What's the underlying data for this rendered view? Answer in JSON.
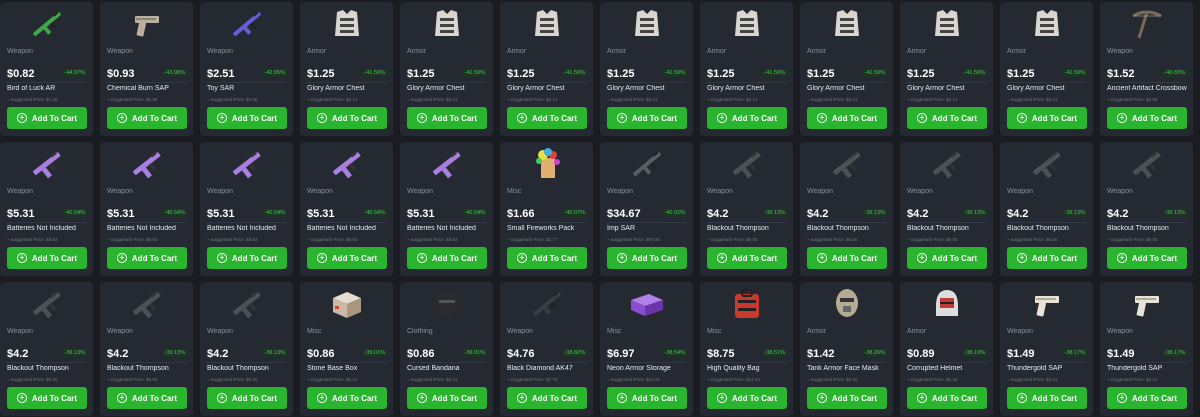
{
  "cart_label": "Add To Cart",
  "suggested_prefix": "Suggested Price:",
  "items": [
    {
      "category": "Weapon",
      "price": "$0.82",
      "discount": "-44.97%",
      "name": "Bird of Luck AR",
      "suggested": "$1.49",
      "icon": "rifle-icon",
      "color": "#3ea84a"
    },
    {
      "category": "Weapon",
      "price": "$0.93",
      "discount": "-43.98%",
      "name": "Chemical Burn SAP",
      "suggested": "$1.66",
      "icon": "pistol-icon",
      "color": "#b9b0a0"
    },
    {
      "category": "Weapon",
      "price": "$2.51",
      "discount": "-42.95%",
      "name": "Toy SAR",
      "suggested": "$4.40",
      "icon": "rifle-icon",
      "color": "#6c5bd8"
    },
    {
      "category": "Armor",
      "price": "$1.25",
      "discount": "-41.59%",
      "name": "Glory Armor Chest",
      "suggested": "$2.14",
      "icon": "armor-chest-icon",
      "color": "#d9d6cf"
    },
    {
      "category": "Armor",
      "price": "$1.25",
      "discount": "-41.59%",
      "name": "Glory Armor Chest",
      "suggested": "$2.14",
      "icon": "armor-chest-icon",
      "color": "#d9d6cf"
    },
    {
      "category": "Armor",
      "price": "$1.25",
      "discount": "-41.59%",
      "name": "Glory Armor Chest",
      "suggested": "$2.14",
      "icon": "armor-chest-icon",
      "color": "#d9d6cf"
    },
    {
      "category": "Armor",
      "price": "$1.25",
      "discount": "-41.59%",
      "name": "Glory Armor Chest",
      "suggested": "$2.14",
      "icon": "armor-chest-icon",
      "color": "#d9d6cf"
    },
    {
      "category": "Armor",
      "price": "$1.25",
      "discount": "-41.59%",
      "name": "Glory Armor Chest",
      "suggested": "$2.14",
      "icon": "armor-chest-icon",
      "color": "#d9d6cf"
    },
    {
      "category": "Armor",
      "price": "$1.25",
      "discount": "-41.59%",
      "name": "Glory Armor Chest",
      "suggested": "$2.14",
      "icon": "armor-chest-icon",
      "color": "#d9d6cf"
    },
    {
      "category": "Armor",
      "price": "$1.25",
      "discount": "-41.59%",
      "name": "Glory Armor Chest",
      "suggested": "$2.14",
      "icon": "armor-chest-icon",
      "color": "#d9d6cf"
    },
    {
      "category": "Armor",
      "price": "$1.25",
      "discount": "-41.59%",
      "name": "Glory Armor Chest",
      "suggested": "$2.14",
      "icon": "armor-chest-icon",
      "color": "#d9d6cf"
    },
    {
      "category": "Weapon",
      "price": "$1.52",
      "discount": "-40.83%",
      "name": "Ancient Artifact Crossbow",
      "suggested": "$2.56",
      "icon": "crossbow-icon",
      "color": "#7a6a55"
    },
    {
      "category": "Weapon",
      "price": "$5.31",
      "discount": "-40.54%",
      "name": "Batteries Not Included",
      "suggested": "$8.93",
      "icon": "smg-icon",
      "color": "#a87ee0"
    },
    {
      "category": "Weapon",
      "price": "$5.31",
      "discount": "-40.54%",
      "name": "Batteries Not Included",
      "suggested": "$8.93",
      "icon": "smg-icon",
      "color": "#a87ee0"
    },
    {
      "category": "Weapon",
      "price": "$5.31",
      "discount": "-40.54%",
      "name": "Batteries Not Included",
      "suggested": "$8.93",
      "icon": "smg-icon",
      "color": "#a87ee0"
    },
    {
      "category": "Weapon",
      "price": "$5.31",
      "discount": "-40.54%",
      "name": "Batteries Not Included",
      "suggested": "$8.93",
      "icon": "smg-icon",
      "color": "#a87ee0"
    },
    {
      "category": "Weapon",
      "price": "$5.31",
      "discount": "-40.54%",
      "name": "Batteries Not Included",
      "suggested": "$8.93",
      "icon": "smg-icon",
      "color": "#a87ee0"
    },
    {
      "category": "Misc",
      "price": "$1.66",
      "discount": "-40.07%",
      "name": "Small Fireworks Pack",
      "suggested": "$2.77",
      "icon": "fireworks-icon",
      "color": "#e0b070"
    },
    {
      "category": "Weapon",
      "price": "$34.67",
      "discount": "-40.02%",
      "name": "Imp SAR",
      "suggested": "$57.80",
      "icon": "rifle-icon",
      "color": "#5a5d63"
    },
    {
      "category": "Weapon",
      "price": "$4.2",
      "discount": "-39.13%",
      "name": "Blackout Thompson",
      "suggested": "$6.90",
      "icon": "smg-icon",
      "color": "#4d5056"
    },
    {
      "category": "Weapon",
      "price": "$4.2",
      "discount": "-39.13%",
      "name": "Blackout Thompson",
      "suggested": "$6.90",
      "icon": "smg-icon",
      "color": "#4d5056"
    },
    {
      "category": "Weapon",
      "price": "$4.2",
      "discount": "-39.13%",
      "name": "Blackout Thompson",
      "suggested": "$6.90",
      "icon": "smg-icon",
      "color": "#4d5056"
    },
    {
      "category": "Weapon",
      "price": "$4.2",
      "discount": "-39.13%",
      "name": "Blackout Thompson",
      "suggested": "$6.90",
      "icon": "smg-icon",
      "color": "#4d5056"
    },
    {
      "category": "Weapon",
      "price": "$4.2",
      "discount": "-39.13%",
      "name": "Blackout Thompson",
      "suggested": "$6.90",
      "icon": "smg-icon",
      "color": "#4d5056"
    },
    {
      "category": "Weapon",
      "price": "$4.2",
      "discount": "-39.13%",
      "name": "Blackout Thompson",
      "suggested": "$6.90",
      "icon": "smg-icon",
      "color": "#4d5056"
    },
    {
      "category": "Weapon",
      "price": "$4.2",
      "discount": "-39.13%",
      "name": "Blackout Thompson",
      "suggested": "$6.90",
      "icon": "smg-icon",
      "color": "#4d5056"
    },
    {
      "category": "Weapon",
      "price": "$4.2",
      "discount": "-39.13%",
      "name": "Blackout Thompson",
      "suggested": "$6.90",
      "icon": "smg-icon",
      "color": "#4d5056"
    },
    {
      "category": "Misc",
      "price": "$0.86",
      "discount": "-39.01%",
      "name": "Stone Base Box",
      "suggested": "$1.41",
      "icon": "box-icon",
      "color": "#c9b9a6"
    },
    {
      "category": "Clothing",
      "price": "$0.86",
      "discount": "-39.01%",
      "name": "Cursed Bandana",
      "suggested": "$1.41",
      "icon": "bandana-icon",
      "color": "#2b2b2f"
    },
    {
      "category": "Weapon",
      "price": "$4.76",
      "discount": "-38.82%",
      "name": "Black Diamond AK47",
      "suggested": "$7.78",
      "icon": "rifle-icon",
      "color": "#3a3d44"
    },
    {
      "category": "Misc",
      "price": "$6.97",
      "discount": "-38.54%",
      "name": "Neon Armor Storage",
      "suggested": "$11.34",
      "icon": "storage-icon",
      "color": "#8a4fd0"
    },
    {
      "category": "Misc",
      "price": "$8.75",
      "discount": "-38.51%",
      "name": "High Quality Bag",
      "suggested": "$14.23",
      "icon": "bag-icon",
      "color": "#c73a2e"
    },
    {
      "category": "Armor",
      "price": "$1.42",
      "discount": "-38.26%",
      "name": "Tank Armor Face Mask",
      "suggested": "$2.30",
      "icon": "mask-icon",
      "color": "#b5ab95"
    },
    {
      "category": "Armor",
      "price": "$0.89",
      "discount": "-38.19%",
      "name": "Corrupted Helmet",
      "suggested": "$1.44",
      "icon": "helmet-icon",
      "color": "#c23a3a"
    },
    {
      "category": "Weapon",
      "price": "$1.49",
      "discount": "-38.17%",
      "name": "Thundergold SAP",
      "suggested": "$2.41",
      "icon": "pistol-icon",
      "color": "#e8e3d6"
    },
    {
      "category": "Weapon",
      "price": "$1.49",
      "discount": "-38.17%",
      "name": "Thundergold SAP",
      "suggested": "$2.41",
      "icon": "pistol-icon",
      "color": "#e8e3d6"
    }
  ]
}
